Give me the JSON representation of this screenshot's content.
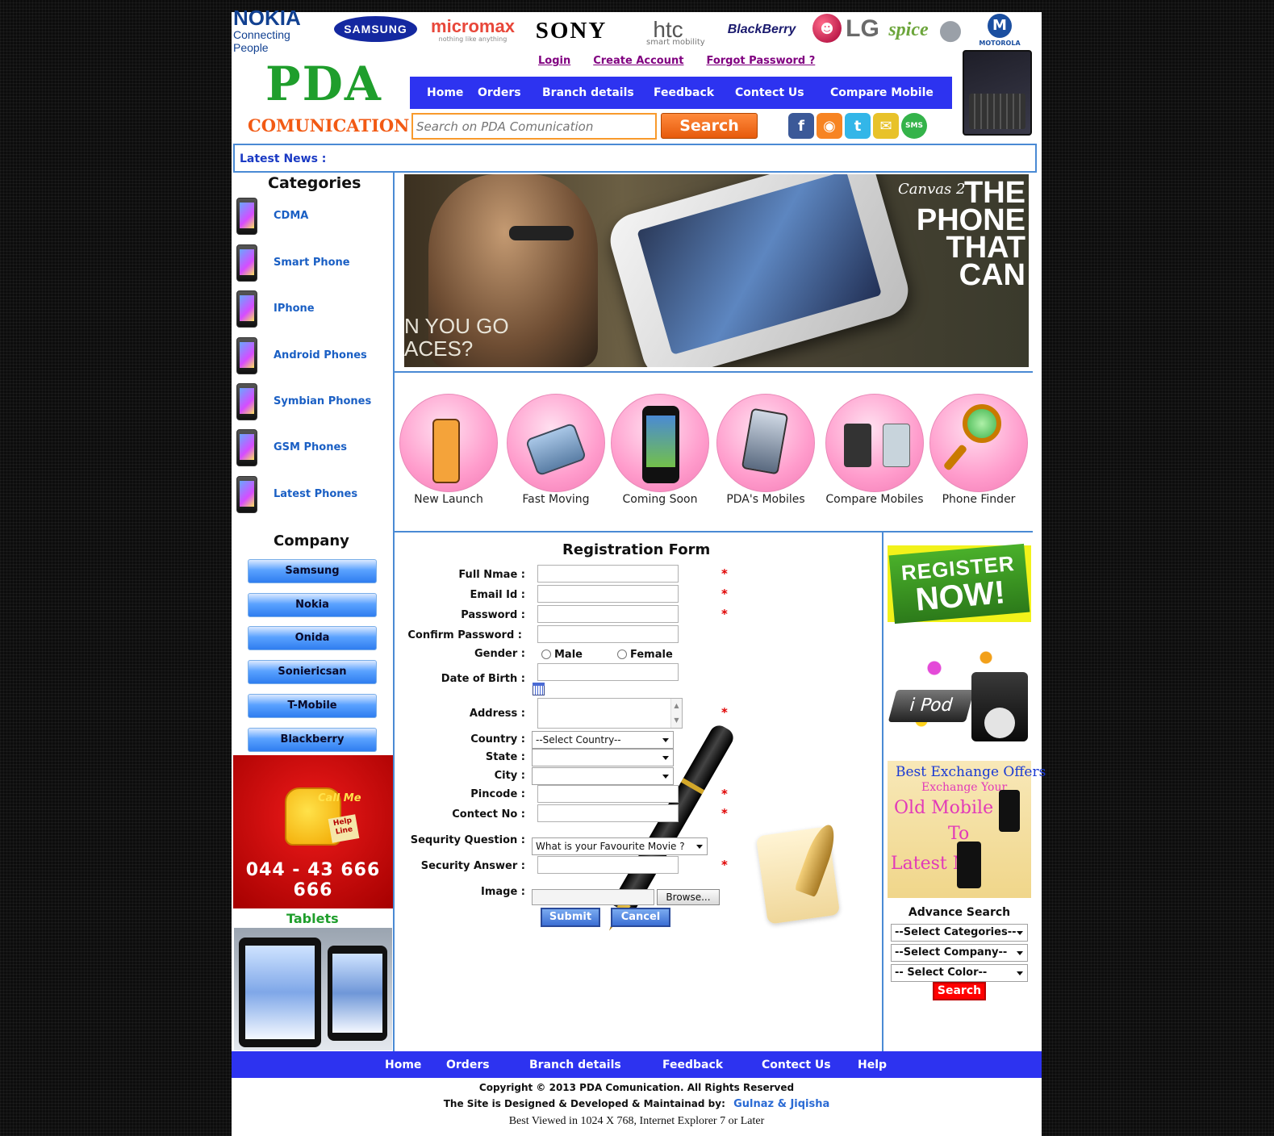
{
  "brands": {
    "nokia": "NOKIA",
    "nokia_tagline": "Connecting People",
    "samsung": "SAMSUNG",
    "micromax": "micromax",
    "micromax_tagline": "nothing like anything",
    "sony": "SONY",
    "htc": "htc",
    "htc_tagline": "smart mobility",
    "blackberry": "BlackBerry",
    "lg": "LG",
    "spice": "spice",
    "motorola": "MOTOROLA"
  },
  "logo": {
    "title": "PDA",
    "subtitle": "COMUNICATION"
  },
  "account_links": [
    "Login",
    "Create Account",
    "Forgot Password ?"
  ],
  "top_nav": [
    "Home",
    "Orders",
    "Branch details",
    "Feedback",
    "Contect Us",
    "Compare Mobile"
  ],
  "search": {
    "placeholder": "Search on PDA Comunication",
    "button": "Search"
  },
  "social_icons": [
    "facebook-icon",
    "rss-icon",
    "twitter-icon",
    "mail-icon",
    "sms-icon"
  ],
  "sms_label": "SMS",
  "latest_news": "Latest News :",
  "categories": {
    "title": "Categories",
    "items": [
      "CDMA",
      "Smart Phone",
      "IPhone",
      "Android Phones",
      "Symbian Phones",
      "GSM Phones",
      "Latest Phones"
    ]
  },
  "company": {
    "title": "Company",
    "items": [
      "Samsung",
      "Nokia",
      "Onida",
      "Soniericsan",
      "T-Mobile",
      "Blackberry"
    ]
  },
  "callme": {
    "call_me": "Call Me",
    "help_line": "Help Line",
    "number": "044 - 43 666 666"
  },
  "tablets_title": "Tablets",
  "banner": {
    "product": "Canvas 2",
    "tagline": [
      "THE",
      "PHONE",
      "THAT",
      "CAN"
    ],
    "partial_text": [
      "N YOU GO",
      "ACES?"
    ]
  },
  "features": [
    "New Launch",
    "Fast Moving",
    "Coming Soon",
    "PDA's Mobiles",
    "Compare Mobiles",
    "Phone Finder"
  ],
  "form": {
    "title": "Registration Form",
    "full_name": "Full Nmae :",
    "email": "Email Id :",
    "password": "Password :",
    "confirm_password": "Confirm Password :",
    "gender": "Gender :",
    "male": "Male",
    "female": "Female",
    "dob": "Date of Birth :",
    "address": "Address :",
    "country": "Country :",
    "country_value": "--Select Country--",
    "state": "State :",
    "city": "City :",
    "pincode": "Pincode :",
    "contact": "Contect No :",
    "security_question": "Sequrity Question :",
    "security_question_value": "What is your Favourite Movie ?",
    "security_answer": "Security Answer :",
    "image": "Image :",
    "browse": "Browse...",
    "submit": "Submit",
    "cancel": "Cancel",
    "required_mark": "*"
  },
  "sidebar_right": {
    "register": [
      "REGISTER",
      "NOW!"
    ],
    "ipod": "i Pod",
    "exchange": [
      "Best Exchange Offers",
      "Exchange Your",
      "Old Mobile",
      "To",
      "Latest Mobile"
    ],
    "advance_search": "Advance Search",
    "select_categories": "--Select Categories--",
    "select_company": "--Select Company--",
    "select_color": "-- Select Color--",
    "search_button": "Search"
  },
  "footer": {
    "nav": [
      "Home",
      "Orders",
      "Branch details",
      "Feedback",
      "Contect Us",
      "Help"
    ],
    "copyright": "Copyright © 2013 PDA Comunication. All Rights Reserved",
    "designed_by": "The Site is Designed & Developed & Maintainad by:",
    "designers": "Gulnaz & Jiqisha",
    "best_viewed": "Best Viewed in 1024 X 768, Internet Explorer 7 or Later"
  }
}
